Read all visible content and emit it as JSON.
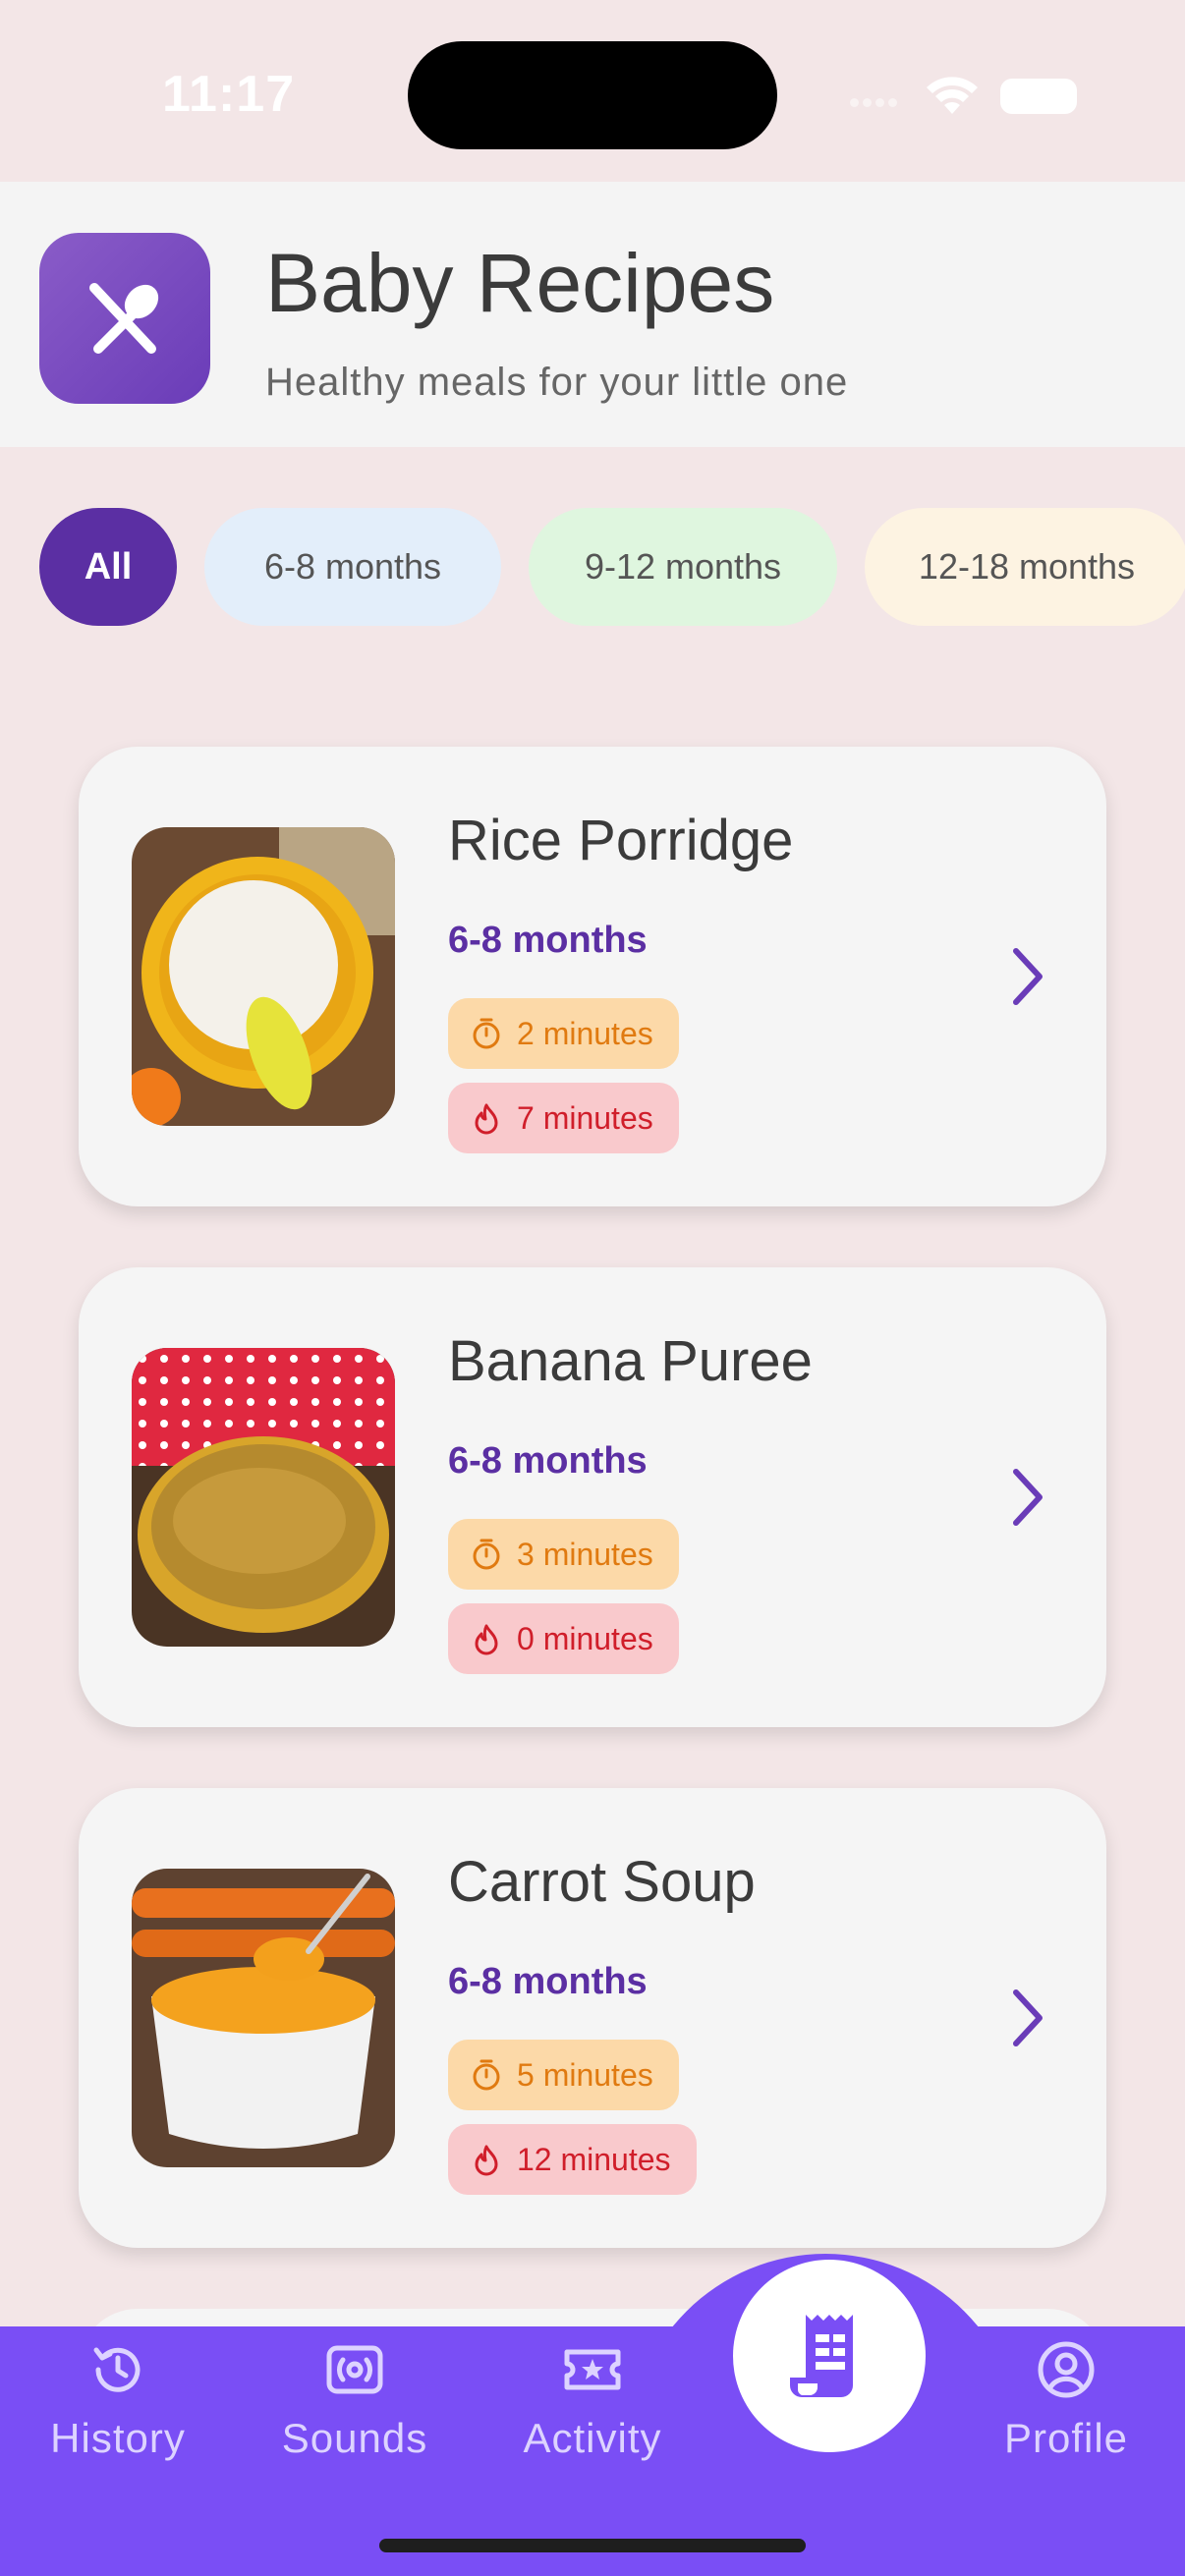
{
  "status": {
    "time": "11:17"
  },
  "header": {
    "title": "Baby Recipes",
    "subtitle": "Healthy meals for your little one",
    "logo_icon": "fork-spoon-icon"
  },
  "filters": [
    {
      "label": "All",
      "selected": true
    },
    {
      "label": "6-8 months",
      "selected": false
    },
    {
      "label": "9-12 months",
      "selected": false
    },
    {
      "label": "12-18 months",
      "selected": false
    }
  ],
  "recipes": [
    {
      "name": "Rice Porridge",
      "age": "6-8 months",
      "prep": "2 minutes",
      "cook": "7 minutes"
    },
    {
      "name": "Banana Puree",
      "age": "6-8 months",
      "prep": "3 minutes",
      "cook": "0 minutes"
    },
    {
      "name": "Carrot Soup",
      "age": "6-8 months",
      "prep": "5 minutes",
      "cook": "12 minutes"
    }
  ],
  "nav": {
    "items": [
      {
        "label": "History",
        "icon": "history-icon"
      },
      {
        "label": "Sounds",
        "icon": "sounds-icon"
      },
      {
        "label": "Activity",
        "icon": "ticket-icon"
      },
      {
        "label": "",
        "icon": "recipe-receipt-icon",
        "active": true
      },
      {
        "label": "Profile",
        "icon": "profile-icon"
      }
    ]
  },
  "colors": {
    "accent": "#5b2fa3",
    "nav": "#7a4ef5",
    "background": "#f3e6e7",
    "prep": "#e07a10",
    "cook": "#d01e2a"
  }
}
